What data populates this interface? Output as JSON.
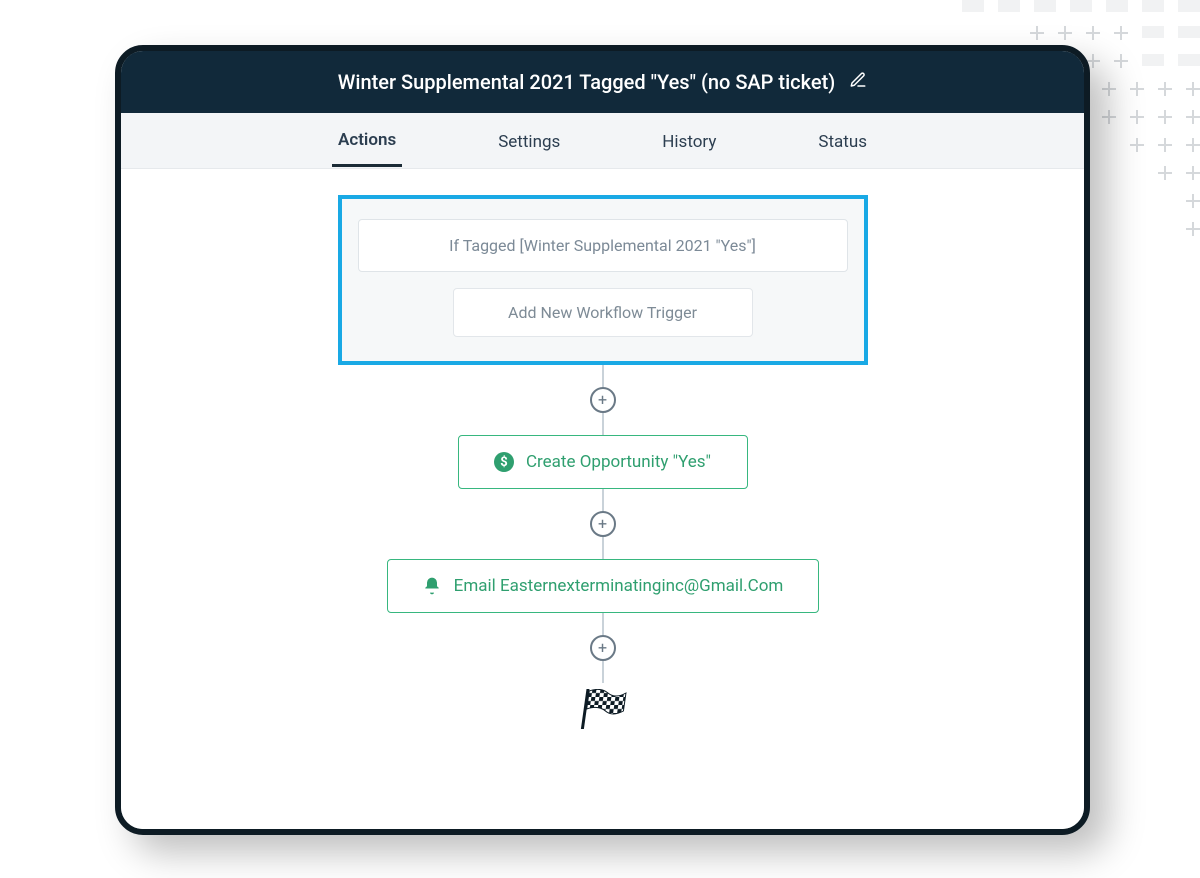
{
  "header": {
    "title": "Winter Supplemental 2021 Tagged \"Yes\" (no SAP ticket)"
  },
  "tabs": {
    "actions": "Actions",
    "settings": "Settings",
    "history": "History",
    "status": "Status",
    "active": "actions"
  },
  "trigger": {
    "condition": "If Tagged [Winter Supplemental 2021 \"Yes\"]",
    "add_button": "Add New Workflow Trigger"
  },
  "steps": {
    "opportunity": {
      "label": "Create Opportunity \"Yes\""
    },
    "email": {
      "label": "Email Easternexterminatinginc@Gmail.Com"
    }
  },
  "icons": {
    "edit": "pencil-icon",
    "dollar": "dollar-icon",
    "bell": "bell-icon",
    "flag": "finish-flag-icon",
    "plus": "plus-circle-icon"
  }
}
